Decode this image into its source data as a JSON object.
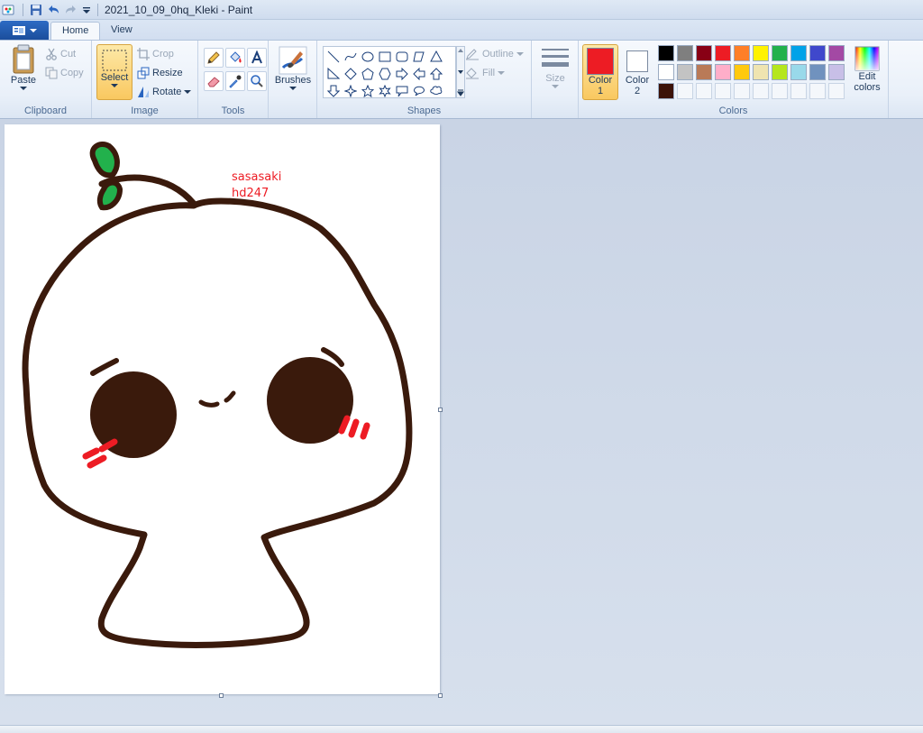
{
  "window": {
    "title": "2021_10_09_0hq_Kleki - Paint"
  },
  "tabs": [
    {
      "label": "Home",
      "active": true
    },
    {
      "label": "View",
      "active": false
    }
  ],
  "clipboard": {
    "paste": "Paste",
    "cut": "Cut",
    "copy": "Copy",
    "group": "Clipboard"
  },
  "image": {
    "select": "Select",
    "crop": "Crop",
    "resize": "Resize",
    "rotate": "Rotate",
    "group": "Image"
  },
  "tools": {
    "group": "Tools"
  },
  "brushes": {
    "label": "Brushes"
  },
  "shapes": {
    "outline": "Outline",
    "fill": "Fill",
    "group": "Shapes"
  },
  "size": {
    "label": "Size"
  },
  "colors": {
    "color1_label": "Color",
    "color1_num": "1",
    "color2_label": "Color",
    "color2_num": "2",
    "edit_label": "Edit",
    "edit_label2": "colors",
    "group": "Colors",
    "color1": "#ed1c24",
    "color2": "#ffffff",
    "palette_row1": [
      "#000000",
      "#7f7f7f",
      "#880015",
      "#ed1c24",
      "#ff7f27",
      "#fff200",
      "#22b14c",
      "#00a2e8",
      "#3f48cc",
      "#a349a4"
    ],
    "palette_row2": [
      "#ffffff",
      "#c3c3c3",
      "#b97a57",
      "#ffaec9",
      "#ffc90e",
      "#efe4b0",
      "#b5e61d",
      "#99d9ea",
      "#7092be",
      "#c8bfe7"
    ],
    "palette_row3": [
      "#3b1208",
      "",
      "",
      "",
      "",
      "",
      "",
      "",
      "",
      ""
    ]
  },
  "drawing": {
    "signature_line1": "sasasaki",
    "signature_line2": "hd247",
    "outline_color": "#3a1a0c",
    "leaf_color": "#22b14c",
    "blush_color": "#ed1c24"
  }
}
